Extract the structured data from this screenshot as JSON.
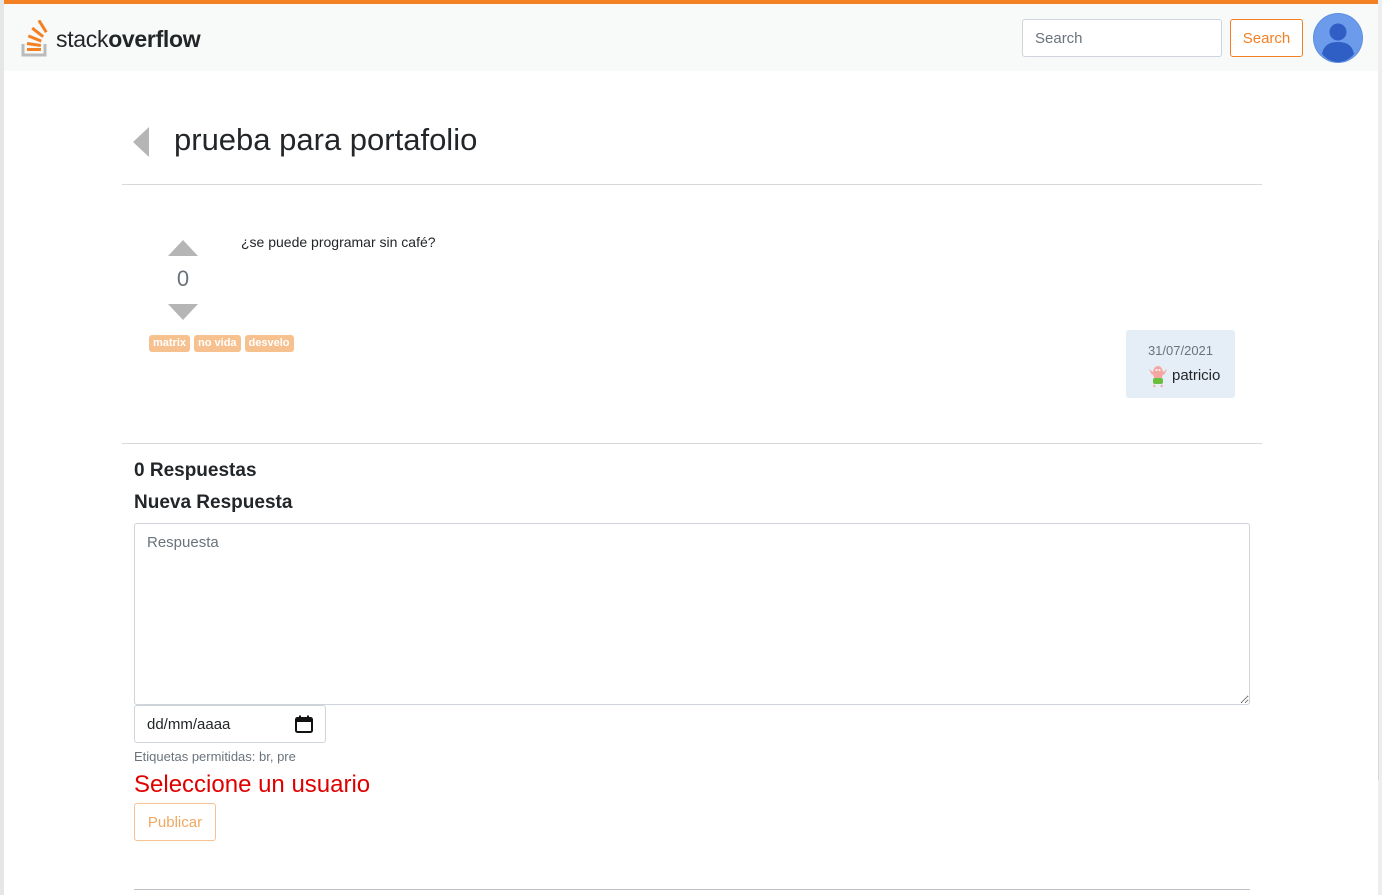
{
  "header": {
    "logo_text_light": "stack",
    "logo_text_bold": "overflow",
    "search_placeholder": "Search",
    "search_button_label": "Search"
  },
  "question": {
    "title": "prueba para portafolio",
    "body": "¿se puede programar sin café?",
    "votes": "0",
    "tags": [
      "matrix",
      "no vida",
      "desvelo"
    ],
    "date": "31/07/2021",
    "author": "patricio"
  },
  "answers": {
    "count_label": "0 Respuestas",
    "new_answer_title": "Nueva Respuesta",
    "textarea_placeholder": "Respuesta",
    "date_placeholder": "dd/mm/aaaa",
    "allowed_tags": "Etiquetas permitidas: br, pre",
    "error_text": "Seleccione un usuario",
    "publish_label": "Publicar"
  },
  "colors": {
    "accent": "#f48024",
    "tag_bg": "#f6c08f",
    "error": "#e00000",
    "user_card_bg": "#e5eef7"
  },
  "icons": {
    "logo": "stackoverflow-logo-icon",
    "avatar": "user-avatar-icon",
    "back": "caret-left-icon",
    "vote_up": "triangle-up-icon",
    "vote_down": "triangle-down-icon",
    "calendar": "calendar-icon"
  }
}
